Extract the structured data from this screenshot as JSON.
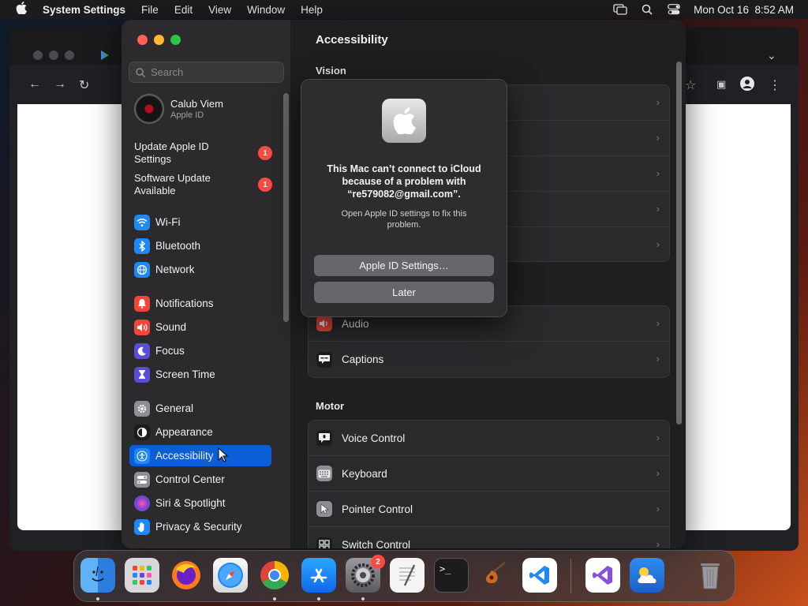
{
  "menubar": {
    "app_name": "System Settings",
    "items": [
      "File",
      "Edit",
      "View",
      "Window",
      "Help"
    ],
    "datetime": "Mon Oct 16  8:52 AM"
  },
  "sidebar": {
    "search_placeholder": "Search",
    "profile": {
      "name": "Calub Viem",
      "subtitle": "Apple ID"
    },
    "notices": [
      {
        "label": "Update Apple ID Settings",
        "badge": "1"
      },
      {
        "label": "Software Update Available",
        "badge": "1"
      }
    ],
    "items": [
      {
        "label": "Wi-Fi",
        "icon": "wifi-icon",
        "color": "#1e88f5"
      },
      {
        "label": "Bluetooth",
        "icon": "bluetooth-icon",
        "color": "#1e88f5"
      },
      {
        "label": "Network",
        "icon": "globe-icon",
        "color": "#1e88f5"
      },
      {
        "label": "Notifications",
        "icon": "bell-icon",
        "color": "#f0463c"
      },
      {
        "label": "Sound",
        "icon": "speaker-icon",
        "color": "#f0463c"
      },
      {
        "label": "Focus",
        "icon": "moon-icon",
        "color": "#5b4ed6"
      },
      {
        "label": "Screen Time",
        "icon": "hourglass-icon",
        "color": "#5b4ed6"
      },
      {
        "label": "General",
        "icon": "gear-icon",
        "color": "#8e8e93"
      },
      {
        "label": "Appearance",
        "icon": "appearance-icon",
        "color": "#1c1c1e"
      },
      {
        "label": "Accessibility",
        "icon": "accessibility-icon",
        "color": "#1e88f5"
      },
      {
        "label": "Control Center",
        "icon": "toggles-icon",
        "color": "#8e8e93"
      },
      {
        "label": "Siri & Spotlight",
        "icon": "siri-icon",
        "color": "#7a3dd8"
      },
      {
        "label": "Privacy & Security",
        "icon": "hand-icon",
        "color": "#1e88f5"
      }
    ],
    "active_item": "Accessibility"
  },
  "main": {
    "title": "Accessibility",
    "sections": {
      "vision": "Vision",
      "motor": "Motor"
    },
    "hearing_rows": [
      {
        "label": "Audio",
        "icon": "audio-icon",
        "color": "#f0463c"
      },
      {
        "label": "Captions",
        "icon": "captions-icon",
        "color": "#1c1c1e"
      }
    ],
    "motor_rows": [
      {
        "label": "Voice Control",
        "icon": "voice-control-icon",
        "color": "#1c1c1e"
      },
      {
        "label": "Keyboard",
        "icon": "keyboard-icon",
        "color": "#8e8e93"
      },
      {
        "label": "Pointer Control",
        "icon": "pointer-icon",
        "color": "#8e8e93"
      },
      {
        "label": "Switch Control",
        "icon": "switch-control-icon",
        "color": "#1c1c1e"
      }
    ]
  },
  "alert": {
    "title": "This Mac can’t connect to iCloud because of a problem with “re579082@gmail.com”.",
    "message": "Open Apple ID settings to fix this problem.",
    "primary_button": "Apple ID Settings…",
    "secondary_button": "Later"
  },
  "dock": {
    "apps": [
      {
        "name": "Finder",
        "icon": "finder-icon",
        "running": true
      },
      {
        "name": "Launchpad",
        "icon": "launchpad-icon",
        "running": false
      },
      {
        "name": "Firefox",
        "icon": "firefox-icon",
        "running": false
      },
      {
        "name": "Safari",
        "icon": "safari-icon",
        "running": false
      },
      {
        "name": "Chrome",
        "icon": "chrome-icon",
        "running": true
      },
      {
        "name": "App Store",
        "icon": "app-store-icon",
        "running": true
      },
      {
        "name": "System Settings",
        "icon": "system-settings-icon",
        "running": true,
        "badge": "2"
      },
      {
        "name": "TextEdit",
        "icon": "textedit-icon",
        "running": false
      },
      {
        "name": "Terminal",
        "icon": "terminal-icon",
        "running": false
      },
      {
        "name": "GarageBand",
        "icon": "garageband-icon",
        "running": false
      },
      {
        "name": "VS Code",
        "icon": "vscode-icon",
        "running": false
      },
      {
        "name": "Visual Studio",
        "icon": "visual-studio-icon",
        "running": false
      },
      {
        "name": "Weather",
        "icon": "weather-icon",
        "running": false
      },
      {
        "name": "Trash",
        "icon": "trash-icon",
        "running": false
      }
    ]
  }
}
